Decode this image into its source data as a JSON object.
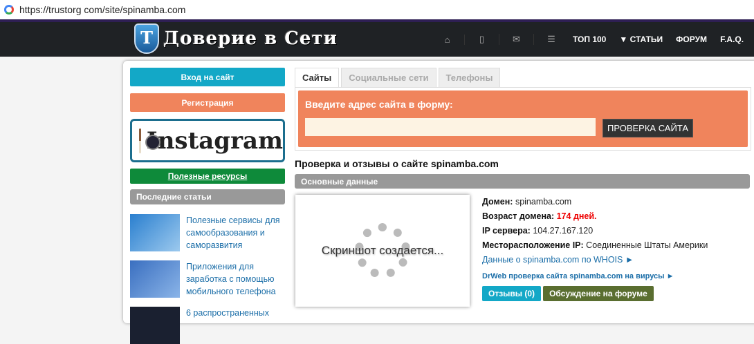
{
  "browser": {
    "url": "https://trustorg com/site/spinamba.com"
  },
  "header": {
    "logo_text": "Доверие в Сети",
    "logo_letter": "Т",
    "nav_icons": [
      "home-icon",
      "mobile-icon",
      "mail-icon",
      "list-icon"
    ],
    "nav": [
      "ТОП 100",
      "▼ СТАТЬИ",
      "ФОРУМ",
      "F.A.Q."
    ]
  },
  "sidebar": {
    "login": "Вход на сайт",
    "register": "Регистрация",
    "instagram": "Instagram",
    "resources": "Полезные ресурсы",
    "latest_title": "Последние статьи",
    "articles": [
      "Полезные сервисы для самообразования и саморазвития",
      "Приложения для заработка с помощью мобильного телефона",
      "6 распространенных"
    ]
  },
  "tabs": [
    "Сайты",
    "Социальные сети",
    "Телефоны"
  ],
  "form": {
    "label": "Введите адрес сайта в форму:",
    "input_value": "",
    "button": "ПРОВЕРКА САЙТА"
  },
  "page_title": "Проверка и отзывы о сайте spinamba.com",
  "section": "Основные данные",
  "screenshot_text": "Скриншот создается...",
  "info": {
    "domain_label": "Домен:",
    "domain": "spinamba.com",
    "age_label": "Возраст домена:",
    "age": "174 дней.",
    "ip_label": "IP сервера:",
    "ip": "104.27.167.120",
    "loc_label": "Месторасположение IP:",
    "loc": "Соединенные Штаты Америки",
    "whois": "Данные о spinamba.com по WHOIS ►",
    "drweb": "DrWeb проверка сайта spinamba.com на вирусы ►",
    "reviews": "Отзывы (0)",
    "forum": "Обсуждение на форуме"
  },
  "colors": {
    "login": "#13a8c7",
    "register": "#f0845c",
    "resources": "#0e8a3a",
    "reviews": "#13a8c7",
    "forum": "#5a6e30"
  }
}
